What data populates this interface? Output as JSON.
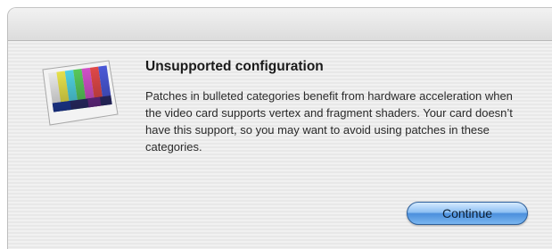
{
  "dialog": {
    "title": "Unsupported configuration",
    "message": "Patches in bulleted categories benefit from hardware acceleration when the video card supports vertex and fragment shaders. Your card doesn’t have this support, so you may want to avoid using patches in these categories.",
    "icon": "color-bars-display-icon",
    "continue_label": "Continue",
    "accent_color": "#4b8fdc"
  }
}
